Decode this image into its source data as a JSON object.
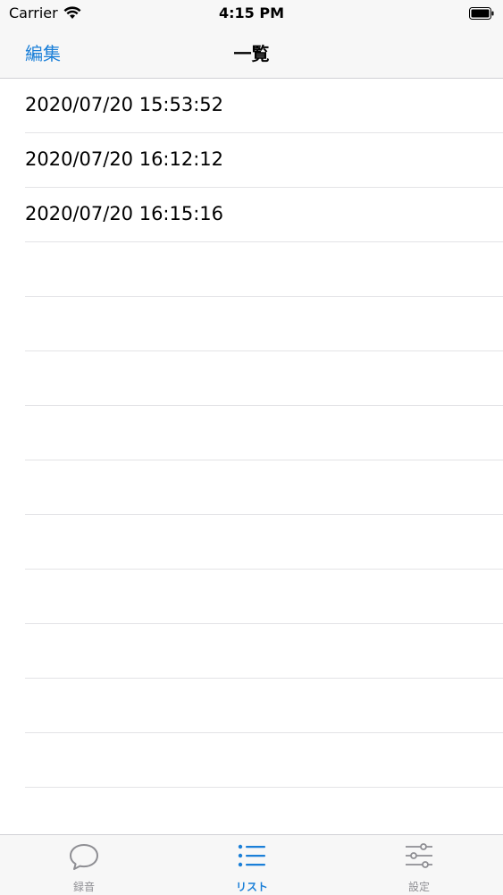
{
  "status_bar": {
    "carrier": "Carrier",
    "time": "4:15 PM"
  },
  "nav": {
    "edit_label": "編集",
    "title": "一覧"
  },
  "recordings": [
    "2020/07/20 15:53:52",
    "2020/07/20 16:12:12",
    "2020/07/20 16:15:16"
  ],
  "tabs": [
    {
      "label": "録音",
      "icon": "speech-bubble-icon",
      "active": false
    },
    {
      "label": "リスト",
      "icon": "list-icon",
      "active": true
    },
    {
      "label": "設定",
      "icon": "sliders-icon",
      "active": false
    }
  ],
  "colors": {
    "accent": "#1a7fd8",
    "inactive": "#8e8e93",
    "bar_bg": "#f7f7f7",
    "separator": "#e3e3e6"
  }
}
